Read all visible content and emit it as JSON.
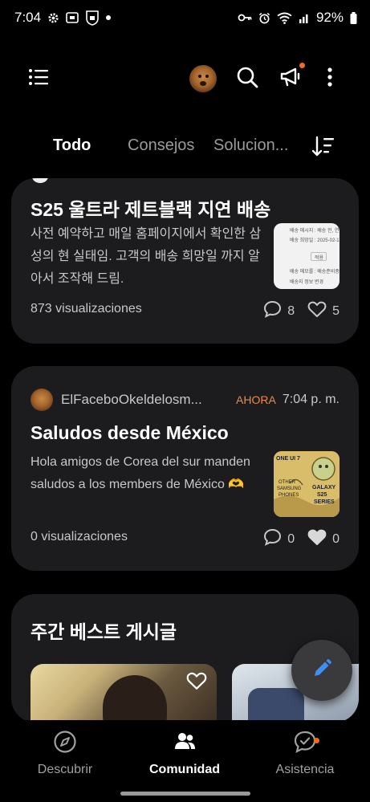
{
  "status_bar": {
    "time": "7:04",
    "battery": "92%"
  },
  "header": {
    "menu_icon": "menu-list-icon",
    "profile_icon": "dog-avatar",
    "search_icon": "search-icon",
    "announce_icon": "megaphone-icon",
    "more_icon": "more-vertical-icon",
    "accent_color": "#f26b1f"
  },
  "tabs": [
    {
      "label": "Todo",
      "active": true
    },
    {
      "label": "Consejos",
      "active": false
    },
    {
      "label": "Solucion...",
      "active": false
    }
  ],
  "posts": [
    {
      "title": "S25 울트라 제트블랙 지연 배송",
      "body": "사전 예약하고 매일 홈페이지에서 확인한 삼성의 현 실태임. 고객의 배송 희망일 까지 알아서 조작해 드림.",
      "views": "873 visualizaciones",
      "comments": "8",
      "likes": "5",
      "liked": false,
      "thumb_lines": [
        "배송 메시지 : 배송 전, 연락",
        "배송 희망일 : 2025-02-17",
        "적용",
        "배송 메모를 : 배송준비중",
        "배송지 정보 변경"
      ]
    },
    {
      "author": "ElFaceboOkeldelosm...",
      "badge": "AHORA",
      "time": "7:04 p. m.",
      "title": "Saludos desde México",
      "body": "Hola amigos de Corea del sur manden saludos a los members de México 🫶",
      "views": "0 visualizaciones",
      "comments": "0",
      "likes": "0",
      "liked": true,
      "meme_text": [
        "ONE UI 7",
        "OTHER",
        "SAMSUNG",
        "PHONES",
        "GALAXY",
        "S25",
        "SERIES"
      ]
    }
  ],
  "weekly": {
    "title": "주간 베스트 게시글"
  },
  "bottom_nav": [
    {
      "label": "Descubrir",
      "icon": "compass-icon",
      "active": false
    },
    {
      "label": "Comunidad",
      "icon": "community-icon",
      "active": true
    },
    {
      "label": "Asistencia",
      "icon": "support-icon",
      "active": false
    }
  ]
}
